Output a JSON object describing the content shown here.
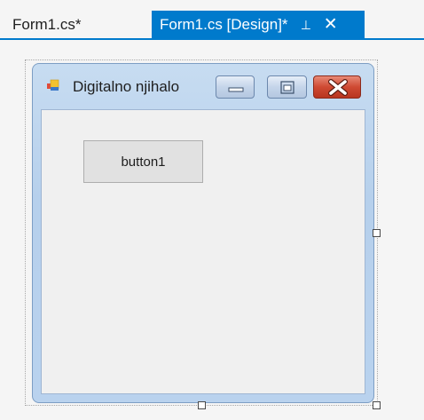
{
  "tabs": [
    {
      "label": "Form1.cs*",
      "active": false
    },
    {
      "label": "Form1.cs [Design]*",
      "active": true
    }
  ],
  "tab_icons": {
    "pin": "pin-icon",
    "close": "close-icon"
  },
  "form": {
    "title": "Digitalno njihalo",
    "icon": "application-icon",
    "controls": [
      "minimize-icon",
      "maximize-icon",
      "close-icon"
    ]
  },
  "button1": {
    "label": "button1"
  },
  "colors": {
    "accent": "#007acc",
    "form_chrome": "#b9d2ee",
    "client_bg": "#f0f0f0",
    "close_button": "#cf4a33",
    "button_face": "#e1e1e1"
  }
}
